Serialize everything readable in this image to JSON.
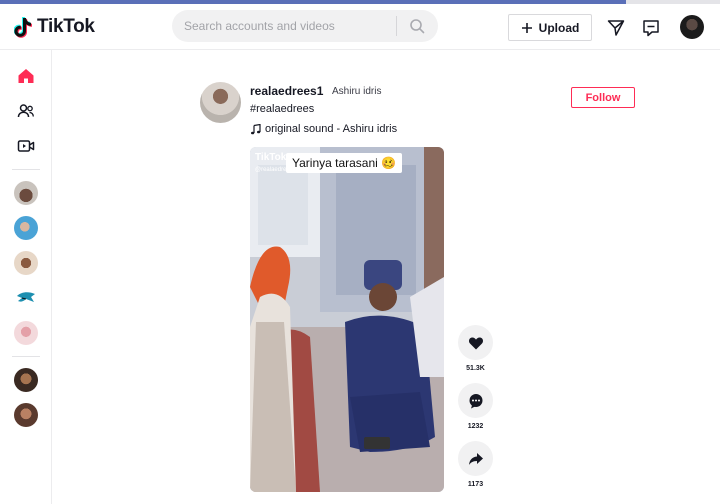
{
  "app": {
    "name": "TikTok"
  },
  "progress": {
    "value": 0.87
  },
  "search": {
    "placeholder": "Search accounts and videos"
  },
  "header": {
    "upload_label": "Upload",
    "icons": [
      "plus-icon",
      "send-icon",
      "inbox-icon",
      "search-icon"
    ]
  },
  "sidebar": {
    "icons": [
      "home-icon",
      "following-icon",
      "live-icon"
    ],
    "accounts": [
      "account-1",
      "account-2",
      "account-3",
      "account-4",
      "account-5",
      "account-6",
      "account-7"
    ]
  },
  "post": {
    "username": "realaedrees1",
    "nickname": "Ashiru idris",
    "hashtag": "#realaedrees",
    "sound": "original sound - Ashiru idris",
    "follow_label": "Follow",
    "video_caption": "Yarinya tarasani 🥴",
    "watermark_brand": "TikTok",
    "watermark_handle": "@realaedrees1"
  },
  "actions": {
    "likes": "51.3K",
    "comments": "1232",
    "shares": "1173"
  },
  "colors": {
    "accent": "#fe2c55",
    "progress": "#5a6fb8",
    "text": "#161823"
  }
}
